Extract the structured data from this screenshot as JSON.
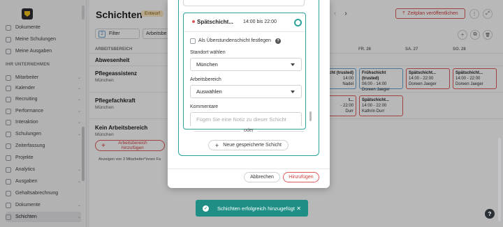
{
  "sidebar": {
    "section_title": "IHR UNTERNEHMEN",
    "items_top": [
      {
        "label": "Dokumente"
      },
      {
        "label": "Meine Schulungen"
      },
      {
        "label": "Meine Ausgaben"
      }
    ],
    "items": [
      {
        "label": "Mitarbeiter",
        "chevron": "⌄"
      },
      {
        "label": "Kalender",
        "chevron": "⌄"
      },
      {
        "label": "Recruiting",
        "chevron": "⌄"
      },
      {
        "label": "Performance",
        "chevron": "⌄"
      },
      {
        "label": "Interaktion",
        "chevron": "⌄"
      },
      {
        "label": "Schulungen",
        "chevron": "⌄"
      },
      {
        "label": "Zeiterfassung",
        "chevron": ""
      },
      {
        "label": "Projekte",
        "chevron": ""
      },
      {
        "label": "Analytics",
        "chevron": "⌄"
      },
      {
        "label": "Ausgaben",
        "chevron": "⌄"
      },
      {
        "label": "Gehaltsabrechnung",
        "chevron": ""
      },
      {
        "label": "Dokumente",
        "chevron": "⌄"
      },
      {
        "label": "Schichten",
        "chevron": "⌄"
      }
    ]
  },
  "header": {
    "title": "Schichten",
    "badge": "Entwurf",
    "publish_label": "Zeitplan veröffentlichen",
    "prev_arrow": "‹",
    "next_arrow": "›",
    "more_icon": "⋮",
    "expand_icon": "⤢"
  },
  "toolbar": {
    "filter_count": "2",
    "filter_label": "Filter",
    "area_label": "Arbeitsbe",
    "add_icon": "+",
    "copy_icon": "⧉",
    "delete_icon": "🗑"
  },
  "grid": {
    "area_header": "ARBEITSBEREICH",
    "day_headers": [
      "FR. 26",
      "SA. 27",
      "SO. 28"
    ],
    "rows": [
      {
        "label": "Abwesenheit",
        "sub": ""
      },
      {
        "label": "Pflegeassistenz",
        "sub": "München"
      },
      {
        "label": "Pflegefachkraft",
        "sub": "München"
      },
      {
        "label": "Kein Arbeitsbereich",
        "sub": "München"
      }
    ],
    "add_area_label": "Arbeitsbereich hinzufügen",
    "footer_note": "Anzeigen von 3 Mitarbeiter*innen  Fa",
    "cards": [
      {
        "title": "chicht (trusted)",
        "time": "14:00",
        "name": "Nadel",
        "color": "blue"
      },
      {
        "title": "Frühschicht (trusted)",
        "time": "06:00 - 14:00",
        "name": "Doreen Jaeger",
        "color": "blue"
      },
      {
        "title": "Spätschicht...",
        "time": "14:00 - 22:00",
        "name": "Doreen Jaeger",
        "color": "red"
      },
      {
        "title": "Spätschicht...",
        "time": "14:00 - 22:00",
        "name": "Doreen Jaeger",
        "color": "red"
      },
      {
        "title": "Spätschicht...",
        "time": "14:00 - 22:00",
        "name": "Kathrin Durr",
        "color": "red"
      },
      {
        "title": "t...",
        "time": "- 22:00",
        "name": "Durr",
        "color": "red"
      }
    ]
  },
  "modal": {
    "shift_name": "Spätschicht...",
    "shift_time": "14:00 bis 22:00",
    "overtime_label": "Als Überstundenschicht festlegen",
    "help_icon": "?",
    "location_label": "Standort wählen",
    "location_value": "München",
    "area_label": "Arbeitsbereich",
    "area_value": "Auswählen",
    "comment_label": "Kommentare",
    "comment_placeholder": "Fügen Sie eine Notiz zu dieser Schicht",
    "or_label": "oder",
    "saved_shift_label": "Neue gespeicherte Schicht",
    "cancel_label": "Abbrechen",
    "add_label": "Hinzufügen"
  },
  "toast": {
    "message": "Schichten erfolgreich hinzugefügt",
    "check_icon": "✓",
    "close_icon": "✕"
  },
  "help_fab": "?"
}
